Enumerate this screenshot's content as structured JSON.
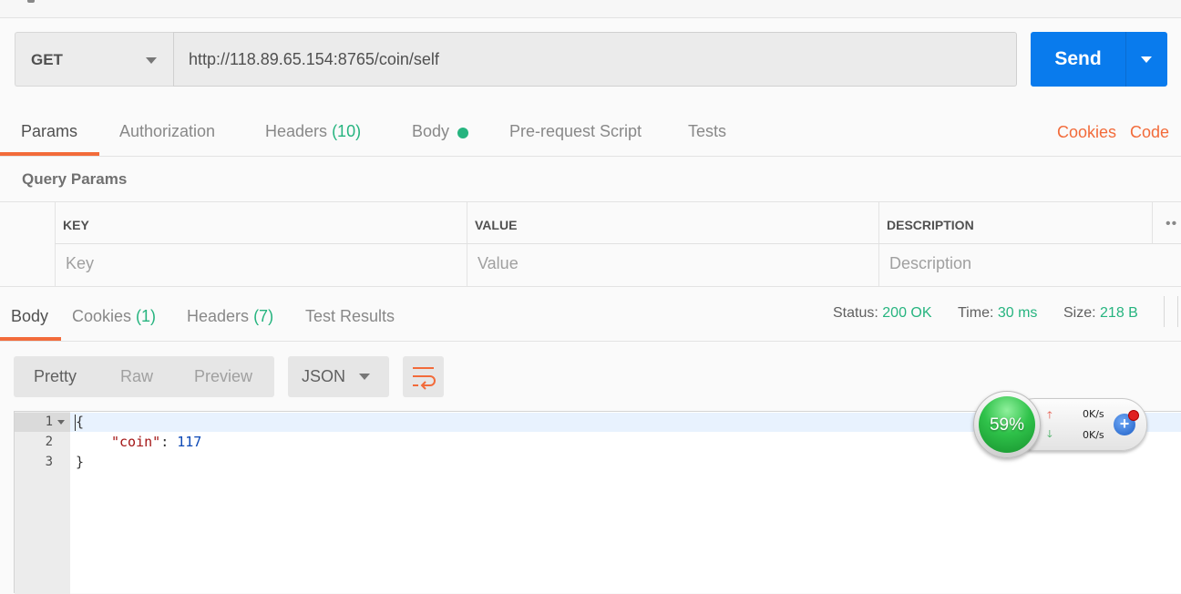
{
  "request": {
    "method": "GET",
    "url": "http://118.89.65.154:8765/coin/self",
    "send_label": "Send"
  },
  "request_tabs": {
    "params": "Params",
    "authorization": "Authorization",
    "headers": "Headers",
    "headers_count": "(10)",
    "body": "Body",
    "pre_request": "Pre-request Script",
    "tests": "Tests",
    "cookies": "Cookies",
    "code": "Code"
  },
  "query_params": {
    "title": "Query Params",
    "columns": [
      "KEY",
      "VALUE",
      "DESCRIPTION"
    ],
    "placeholders": [
      "Key",
      "Value",
      "Description"
    ]
  },
  "response_tabs": {
    "body": "Body",
    "cookies": "Cookies",
    "cookies_count": "(1)",
    "headers": "Headers",
    "headers_count": "(7)",
    "test_results": "Test Results"
  },
  "status": {
    "status_label": "Status:",
    "status_value": "200 OK",
    "time_label": "Time:",
    "time_value": "30 ms",
    "size_label": "Size:",
    "size_value": "218 B"
  },
  "format": {
    "pretty": "Pretty",
    "raw": "Raw",
    "preview": "Preview",
    "language": "JSON"
  },
  "editor": {
    "line_numbers": [
      "1",
      "2",
      "3"
    ],
    "line1": "{",
    "key": "\"coin\"",
    "colon": ": ",
    "value": "117",
    "line3": "}"
  },
  "speed_widget": {
    "percent": "59%",
    "upload": "0K/s",
    "download": "0K/s"
  },
  "colors": {
    "accent_orange": "#f26b3a",
    "send_blue": "#097bed",
    "status_green": "#26b47f"
  }
}
